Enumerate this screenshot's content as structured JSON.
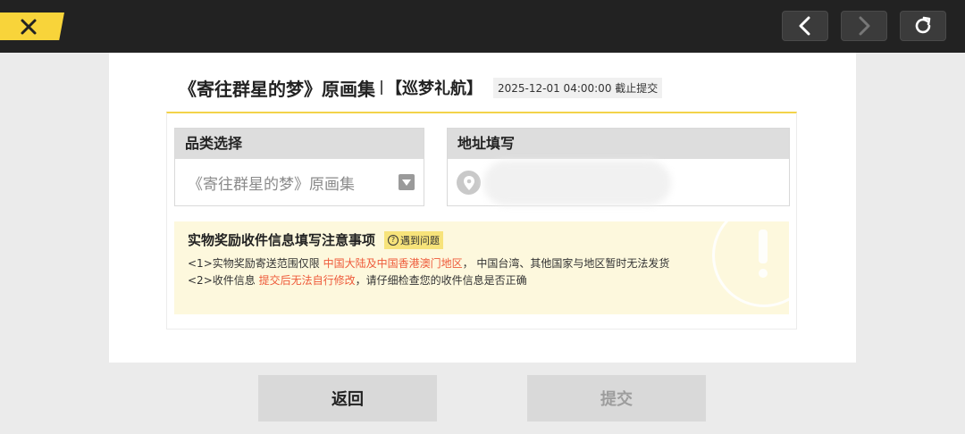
{
  "topbar": {
    "icons": [
      "close-icon",
      "back-arrow-icon",
      "forward-arrow-icon",
      "refresh-icon"
    ],
    "accent_color": "#f8d43a"
  },
  "header": {
    "title": "《寄往群星的梦》原画集",
    "subtitle": "【巡梦礼航】",
    "deadline": "2025-12-01 04:00:00 截止提交"
  },
  "category": {
    "label": "品类选择",
    "selected": "《寄往群星的梦》原画集"
  },
  "address": {
    "label": "地址填写"
  },
  "notice": {
    "title": "实物奖励收件信息填写注意事项",
    "help": "遇到问题",
    "rule1": {
      "prefix": "<1>实物奖励寄送范围仅限 ",
      "highlight": "中国大陆及中国香港澳门地区",
      "suffix": "， 中国台湾、其他国家与地区暂时无法发货"
    },
    "rule2": {
      "prefix": "<2>收件信息 ",
      "highlight": "提交后无法自行修改",
      "suffix": "，请仔细检查您的收件信息是否正确"
    },
    "highlight_color": "#ee5a3a"
  },
  "actions": {
    "back_label": "返回",
    "submit_label": "提交"
  }
}
